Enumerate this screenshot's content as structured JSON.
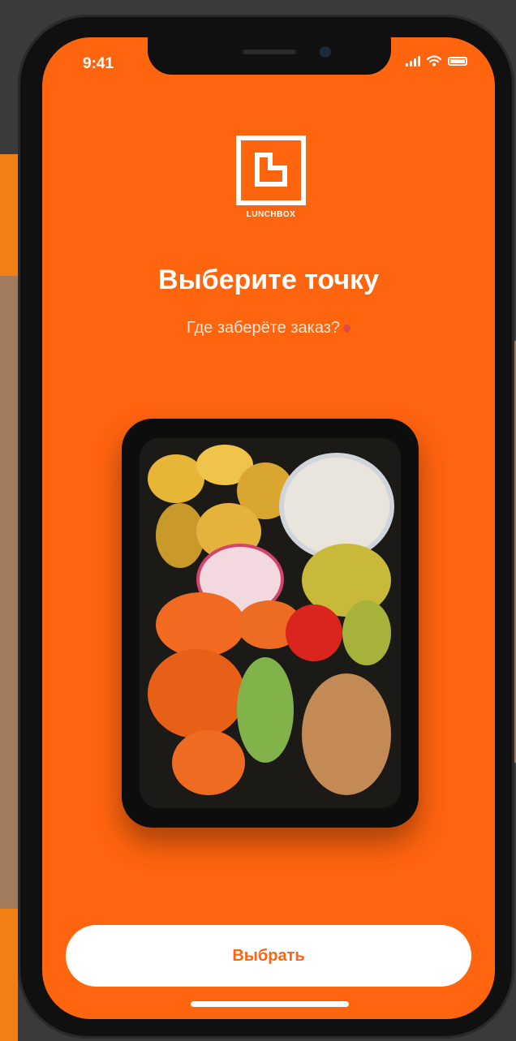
{
  "status_bar": {
    "time": "9:41"
  },
  "logo": {
    "text": "LUNCHBOX"
  },
  "title": "Выберите точку",
  "subtitle": "Где заберёте заказ?",
  "button": {
    "label": "Выбрать"
  },
  "colors": {
    "accent": "#ff640f",
    "button_bg": "#ffffff",
    "text": "#ffffff"
  },
  "icons": [
    "signal-icon",
    "wifi-icon",
    "battery-icon",
    "location-pin-icon",
    "lunchbox-logo-icon"
  ]
}
